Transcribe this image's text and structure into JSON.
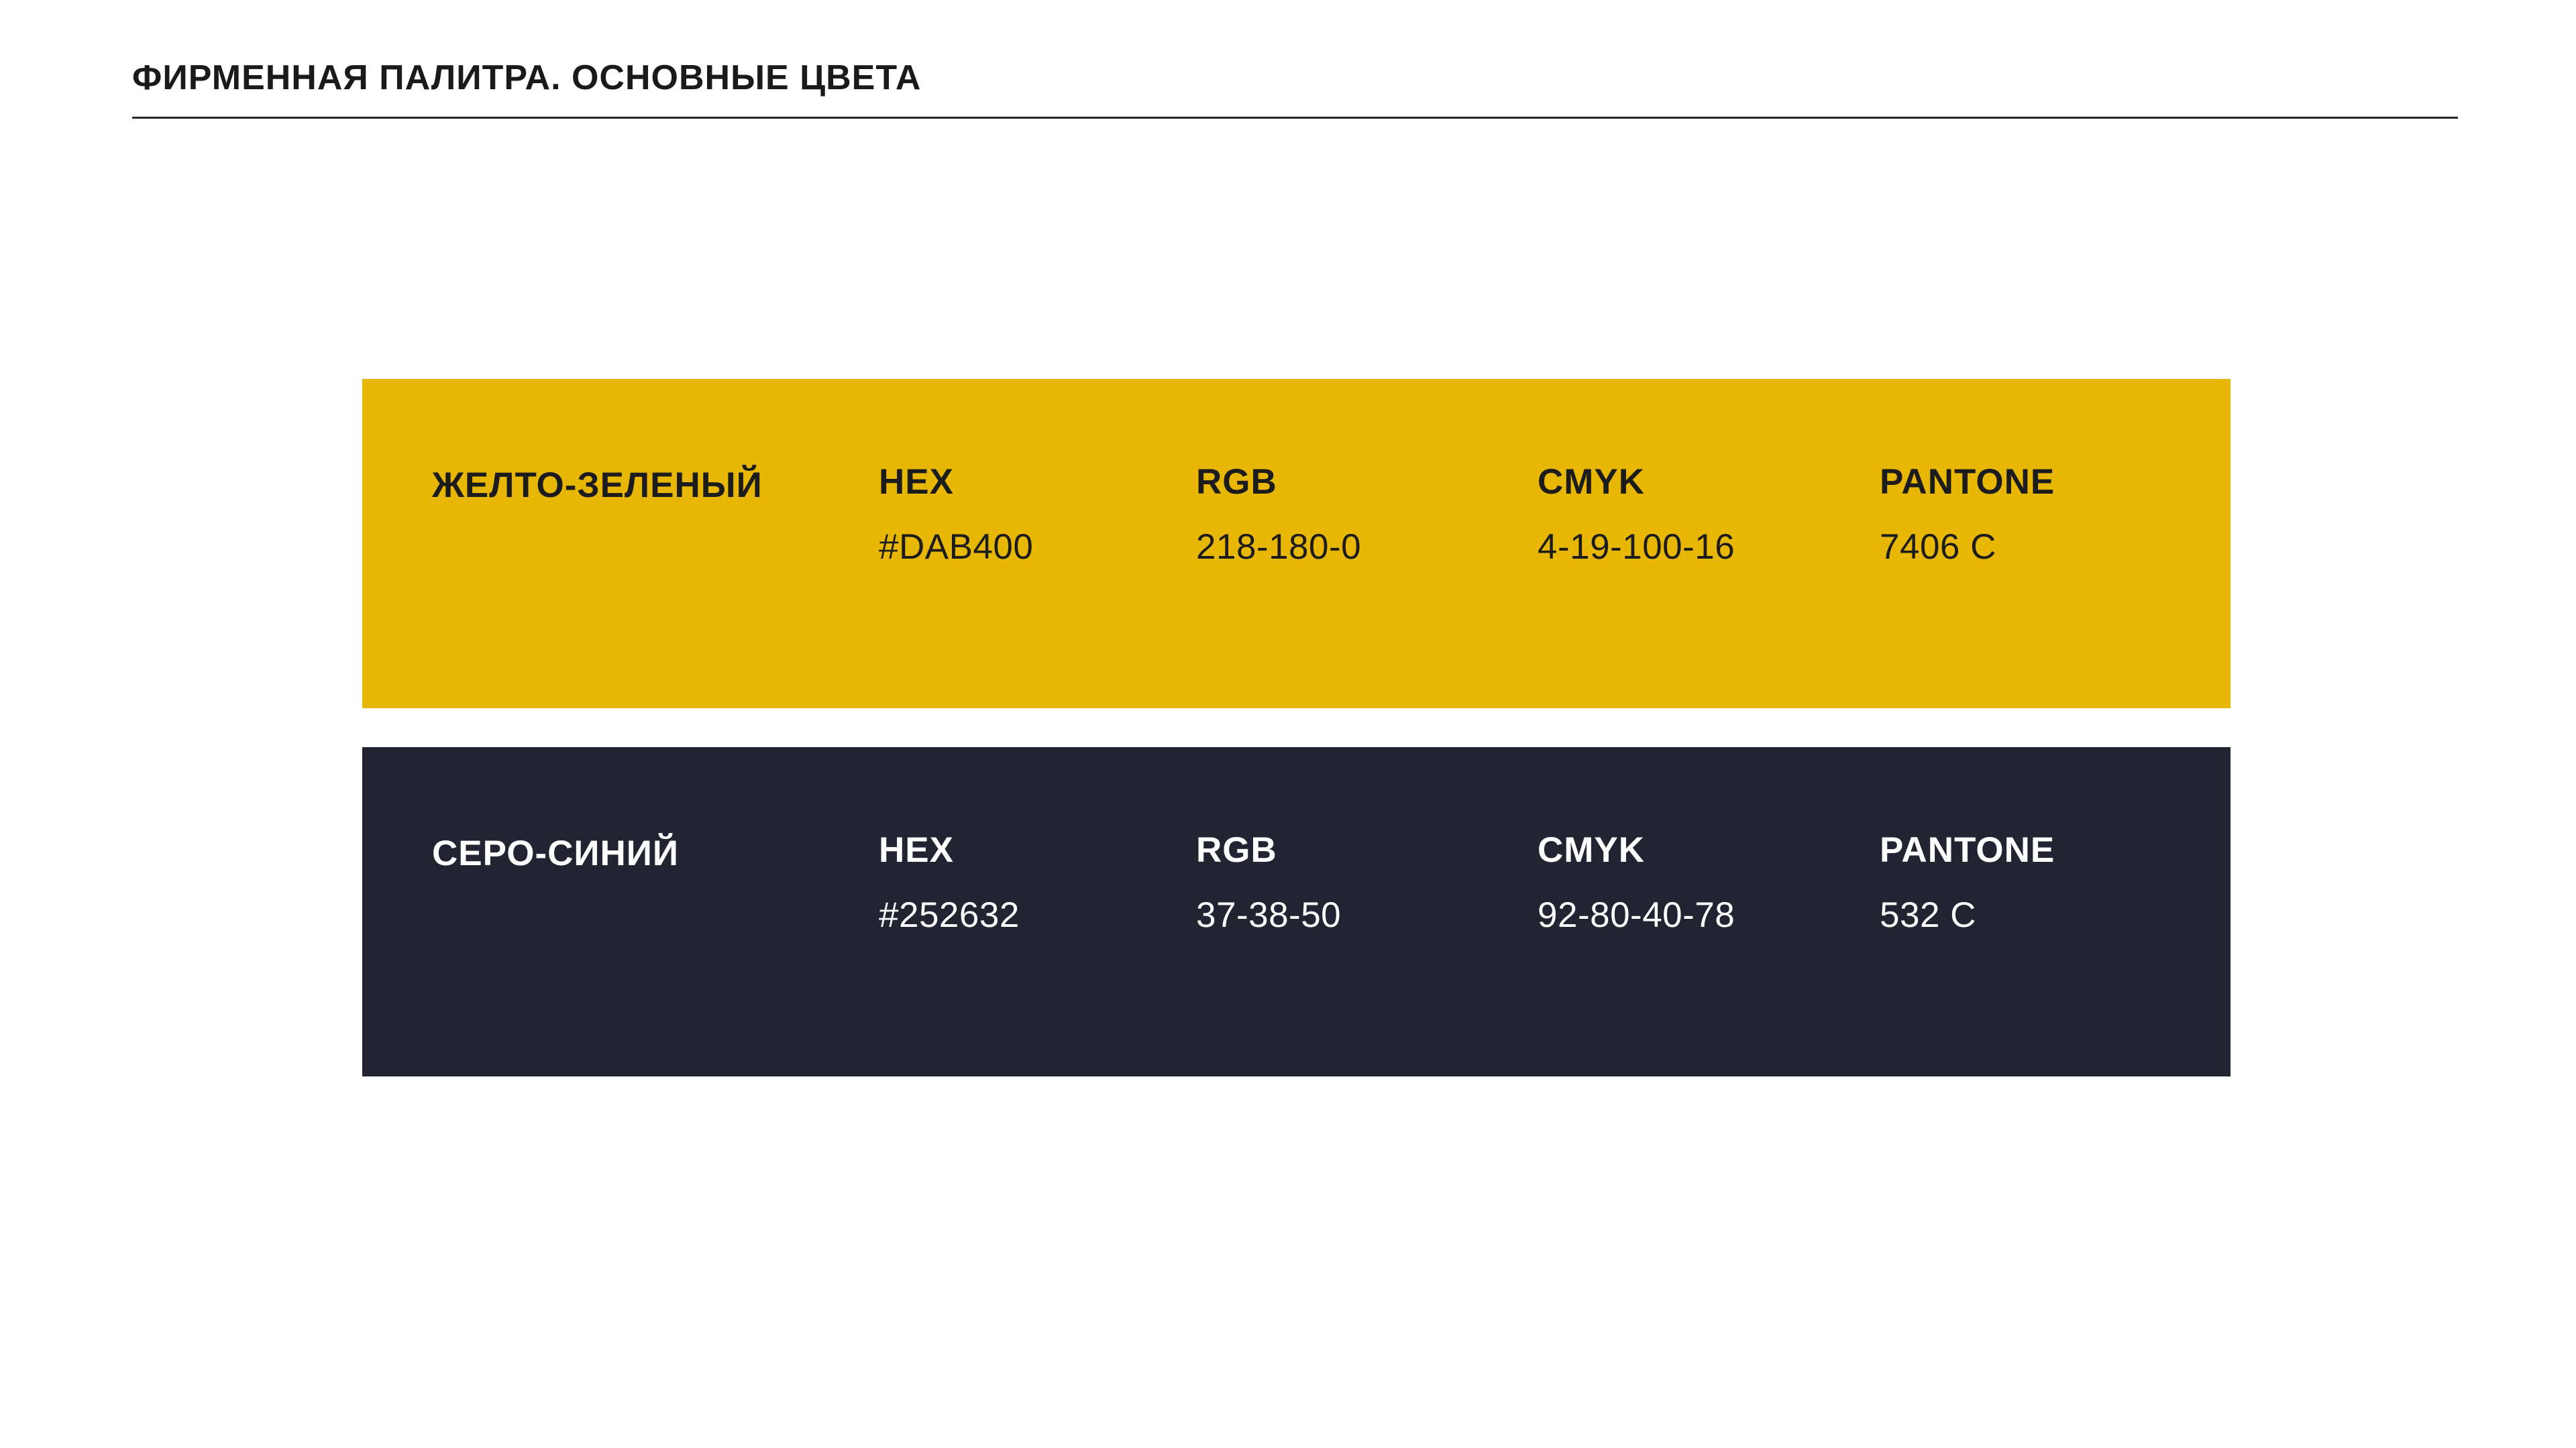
{
  "header": {
    "title": "ФИРМЕННАЯ ПАЛИТРА. ОСНОВНЫЕ ЦВЕТА"
  },
  "labels": {
    "hex": "HEX",
    "rgb": "RGB",
    "cmyk": "CMYK",
    "pantone": "PANTONE"
  },
  "colors": [
    {
      "name": "ЖЕЛТО-ЗЕЛЕНЫЙ",
      "hex": "#DAB400",
      "rgb": "218-180-0",
      "cmyk": "4-19-100-16",
      "pantone": "7406 C",
      "swatch": "#E8B704",
      "text_color": "#1c1c1c"
    },
    {
      "name": "СЕРО-СИНИЙ",
      "hex": "#252632",
      "rgb": "37-38-50",
      "cmyk": "92-80-40-78",
      "pantone": "532 C",
      "swatch": "#222432",
      "text_color": "#ffffff"
    }
  ]
}
